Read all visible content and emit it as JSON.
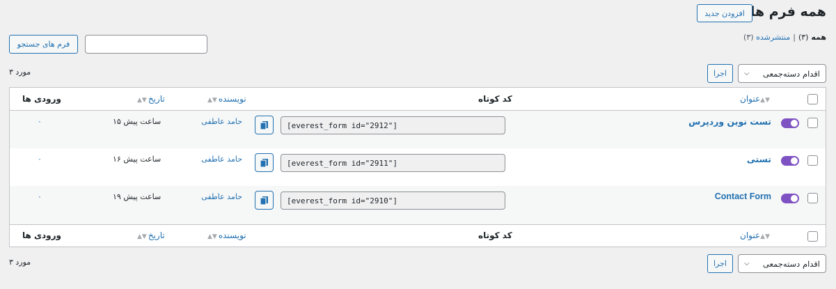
{
  "header": {
    "title": "همه فرم ها",
    "add_new": "افزودن جدید"
  },
  "filters": {
    "all_label": "همه",
    "all_count": "(۳)",
    "sep": "|",
    "published_label": "منتشرشده",
    "published_count": "(۳)"
  },
  "search": {
    "value": "",
    "button": "فرم های جستجو"
  },
  "nav_top": {
    "count": "۳ مورد",
    "bulk": "اقدام دسته‌جمعی",
    "apply": "اجرا"
  },
  "nav_bottom": {
    "count": "۳ مورد",
    "bulk": "اقدام دسته‌جمعی",
    "apply": "اجرا"
  },
  "columns": {
    "title": "عنوان",
    "shortcode": "کد کوتاه",
    "author": "نویسنده",
    "date": "تاریخ",
    "entries": "ورودی ها"
  },
  "rows": [
    {
      "title": "تست نوین وردپرس",
      "shortcode": "[everest_form id=\"2912\"]",
      "author": "حامد عاطفی",
      "date": "۱۵ ساعت پیش",
      "entries": "۰"
    },
    {
      "title": "تستی",
      "shortcode": "[everest_form id=\"2911\"]",
      "author": "حامد عاطفی",
      "date": "۱۶ ساعت پیش",
      "entries": "۰"
    },
    {
      "title": "Contact Form",
      "shortcode": "[everest_form id=\"2910\"]",
      "author": "حامد عاطفی",
      "date": "۱۹ ساعت پیش",
      "entries": "۰"
    }
  ],
  "colors": {
    "accent": "#2271b1",
    "toggle": "#7e52c2"
  }
}
